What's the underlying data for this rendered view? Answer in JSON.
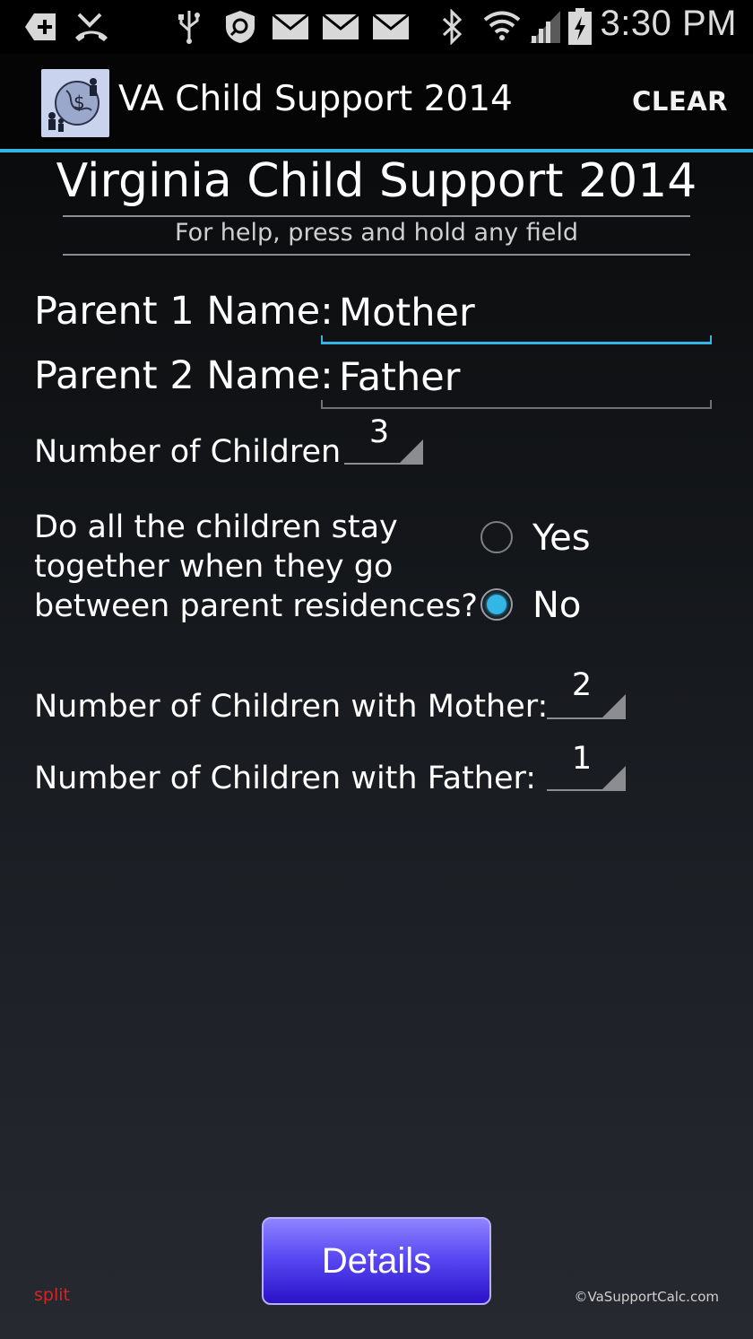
{
  "status_bar": {
    "time": "3:30 PM",
    "icons": [
      "add-notification-icon",
      "missed-call-icon",
      "usb-icon",
      "security-icon",
      "email-icon",
      "email-icon",
      "email-icon",
      "bluetooth-icon",
      "wifi-icon",
      "signal-icon",
      "battery-charging-icon"
    ]
  },
  "action_bar": {
    "app_title": "VA Child Support 2014",
    "clear_label": "CLEAR",
    "accent_color": "#33b5e5"
  },
  "header": {
    "title": "Virginia Child Support 2014",
    "subtitle": "For help, press and hold any field"
  },
  "form": {
    "parent1_label": "Parent 1 Name:",
    "parent1_value": "Mother",
    "parent2_label": "Parent 2 Name:",
    "parent2_value": "Father",
    "children_label": "Number of Children",
    "children_value": "3",
    "question_lines": [
      "Do all the children stay",
      "together when they go",
      "between parent residences?"
    ],
    "option_yes": "Yes",
    "option_no": "No",
    "selected_option": "No",
    "with_mother_label": "Number of Children with Mother:",
    "with_mother_value": "2",
    "with_father_label": "Number of Children with Father:",
    "with_father_value": "1"
  },
  "footer": {
    "details_label": "Details",
    "split_label": "split",
    "copyright": "©VaSupportCalc.com"
  }
}
